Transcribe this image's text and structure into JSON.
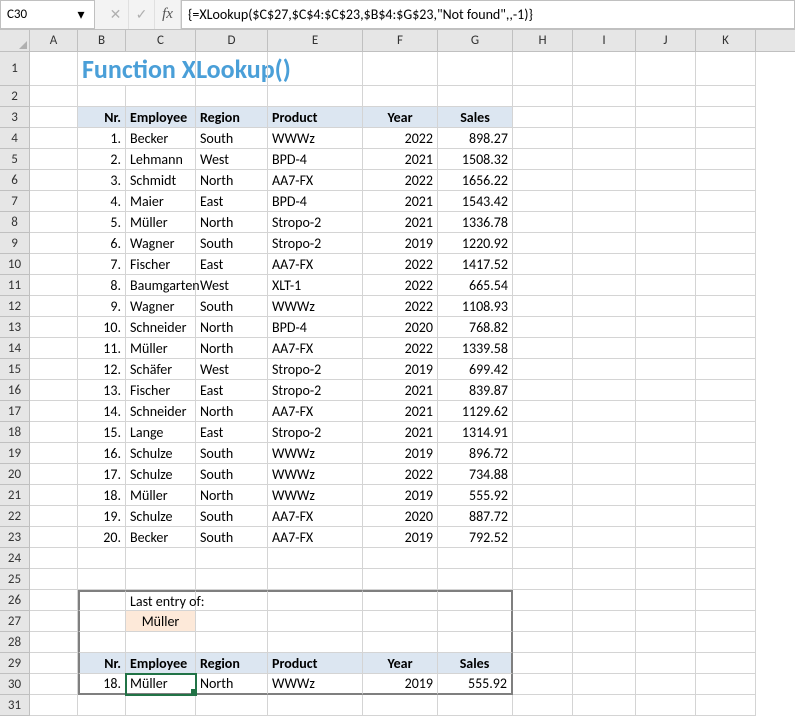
{
  "cellRef": "C30",
  "formula": "{=XLookup($C$27,$C$4:$C$23,$B$4:$G$23,\"Not found\",,-1)}",
  "columns": [
    "A",
    "B",
    "C",
    "D",
    "E",
    "F",
    "G",
    "H",
    "I",
    "J",
    "K"
  ],
  "title": "Function XLookup()",
  "headers": {
    "nr": "Nr.",
    "employee": "Employee",
    "region": "Region",
    "product": "Product",
    "year": "Year",
    "sales": "Sales"
  },
  "table": [
    {
      "nr": "1.",
      "employee": "Becker",
      "region": "South",
      "product": "WWWz",
      "year": "2022",
      "sales": "898.27"
    },
    {
      "nr": "2.",
      "employee": "Lehmann",
      "region": "West",
      "product": "BPD-4",
      "year": "2021",
      "sales": "1508.32"
    },
    {
      "nr": "3.",
      "employee": "Schmidt",
      "region": "North",
      "product": "AA7-FX",
      "year": "2022",
      "sales": "1656.22"
    },
    {
      "nr": "4.",
      "employee": "Maier",
      "region": "East",
      "product": "BPD-4",
      "year": "2021",
      "sales": "1543.42"
    },
    {
      "nr": "5.",
      "employee": "Müller",
      "region": "North",
      "product": "Stropo-2",
      "year": "2021",
      "sales": "1336.78"
    },
    {
      "nr": "6.",
      "employee": "Wagner",
      "region": "South",
      "product": "Stropo-2",
      "year": "2019",
      "sales": "1220.92"
    },
    {
      "nr": "7.",
      "employee": "Fischer",
      "region": "East",
      "product": "AA7-FX",
      "year": "2022",
      "sales": "1417.52"
    },
    {
      "nr": "8.",
      "employee": "Baumgarten",
      "region": "West",
      "product": "XLT-1",
      "year": "2022",
      "sales": "665.54"
    },
    {
      "nr": "9.",
      "employee": "Wagner",
      "region": "South",
      "product": "WWWz",
      "year": "2022",
      "sales": "1108.93"
    },
    {
      "nr": "10.",
      "employee": "Schneider",
      "region": "North",
      "product": "BPD-4",
      "year": "2020",
      "sales": "768.82"
    },
    {
      "nr": "11.",
      "employee": "Müller",
      "region": "North",
      "product": "AA7-FX",
      "year": "2022",
      "sales": "1339.58"
    },
    {
      "nr": "12.",
      "employee": "Schäfer",
      "region": "West",
      "product": "Stropo-2",
      "year": "2019",
      "sales": "699.42"
    },
    {
      "nr": "13.",
      "employee": "Fischer",
      "region": "East",
      "product": "Stropo-2",
      "year": "2021",
      "sales": "839.87"
    },
    {
      "nr": "14.",
      "employee": "Schneider",
      "region": "North",
      "product": "AA7-FX",
      "year": "2021",
      "sales": "1129.62"
    },
    {
      "nr": "15.",
      "employee": "Lange",
      "region": "East",
      "product": "Stropo-2",
      "year": "2021",
      "sales": "1314.91"
    },
    {
      "nr": "16.",
      "employee": "Schulze",
      "region": "South",
      "product": "WWWz",
      "year": "2019",
      "sales": "896.72"
    },
    {
      "nr": "17.",
      "employee": "Schulze",
      "region": "South",
      "product": "WWWz",
      "year": "2022",
      "sales": "734.88"
    },
    {
      "nr": "18.",
      "employee": "Müller",
      "region": "North",
      "product": "WWWz",
      "year": "2019",
      "sales": "555.92"
    },
    {
      "nr": "19.",
      "employee": "Schulze",
      "region": "South",
      "product": "AA7-FX",
      "year": "2020",
      "sales": "887.72"
    },
    {
      "nr": "20.",
      "employee": "Becker",
      "region": "South",
      "product": "AA7-FX",
      "year": "2019",
      "sales": "792.52"
    }
  ],
  "lookup": {
    "label": "Last entry of:",
    "value": "Müller"
  },
  "result": {
    "nr": "18.",
    "employee": "Müller",
    "region": "North",
    "product": "WWWz",
    "year": "2019",
    "sales": "555.92"
  },
  "icons": {
    "dd": "▾",
    "x": "✕",
    "chk": "✓",
    "fx": "fx"
  }
}
